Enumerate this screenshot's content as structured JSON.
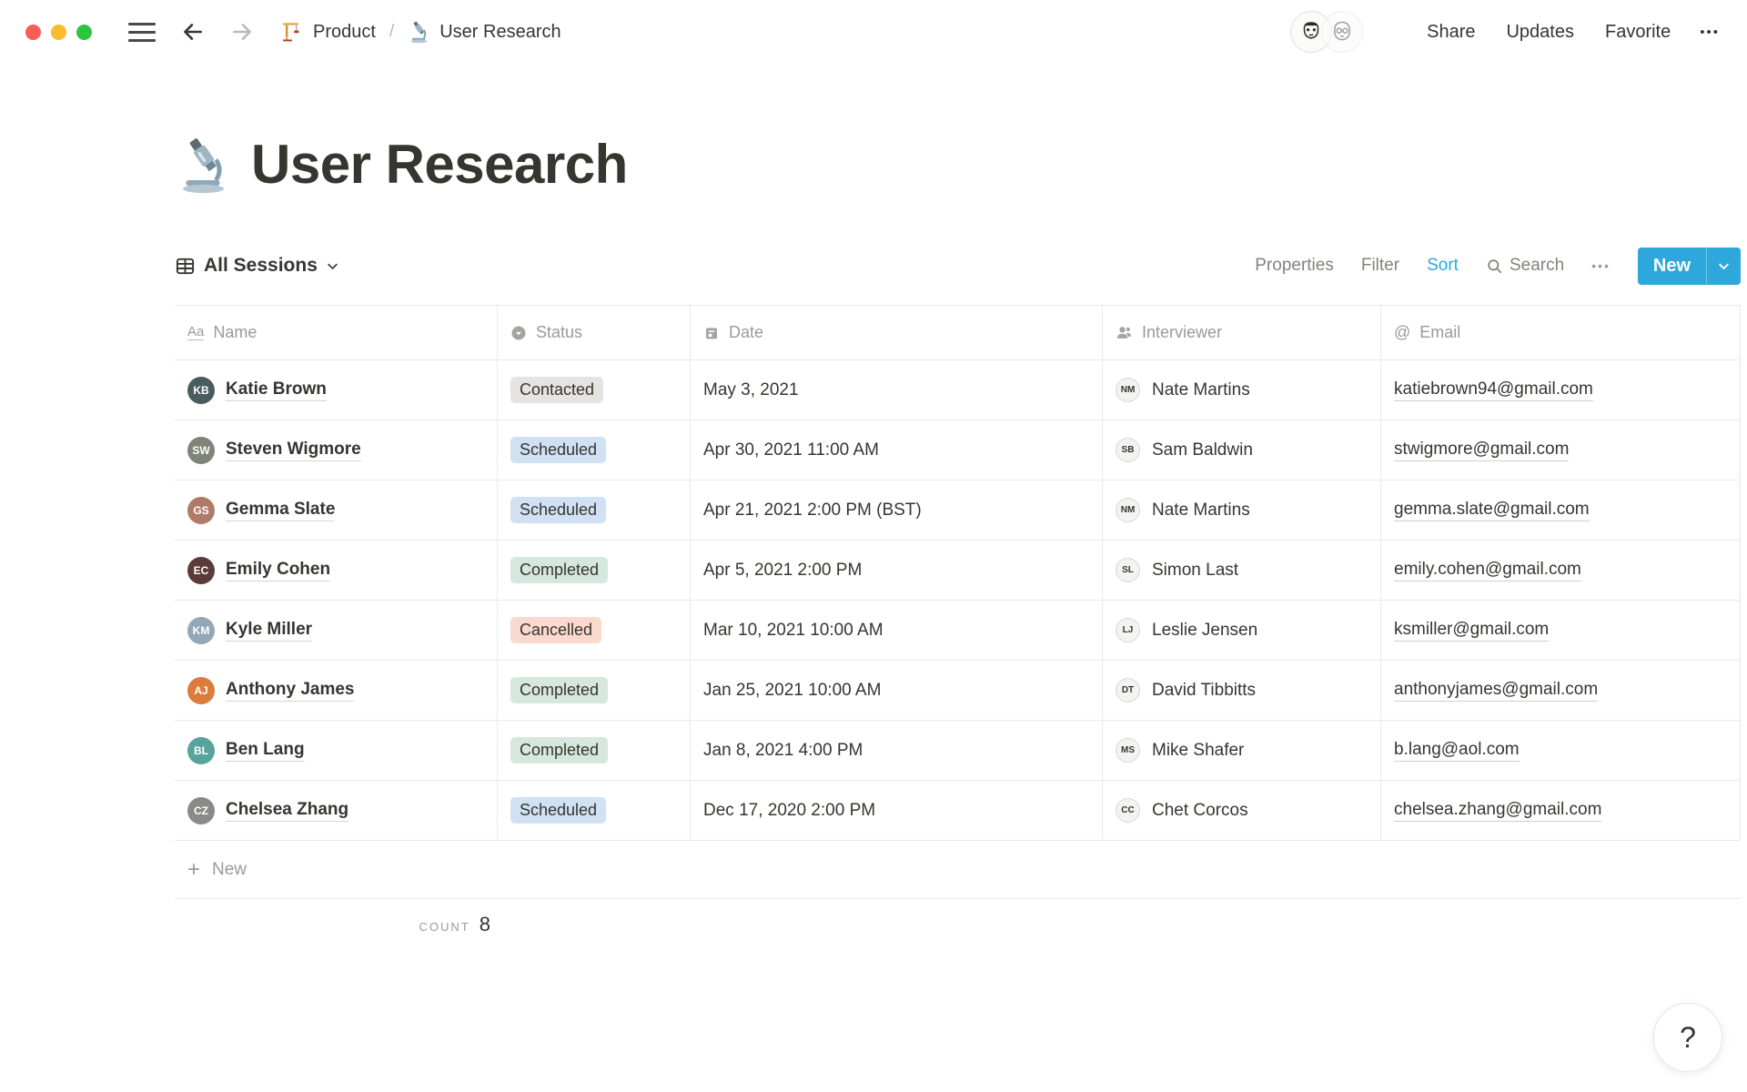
{
  "topbar": {
    "breadcrumb": {
      "parent": "Product",
      "separator": "/",
      "current": "User Research"
    },
    "share": "Share",
    "updates": "Updates",
    "favorite": "Favorite",
    "more": "•••"
  },
  "page": {
    "title": "User Research"
  },
  "view_bar": {
    "view_name": "All Sessions",
    "properties": "Properties",
    "filter": "Filter",
    "sort": "Sort",
    "search": "Search",
    "more": "•••",
    "new_button": "New"
  },
  "table": {
    "columns": [
      {
        "label": "Name",
        "icon": "title-property-icon"
      },
      {
        "label": "Status",
        "icon": "select-property-icon"
      },
      {
        "label": "Date",
        "icon": "calendar-icon"
      },
      {
        "label": "Interviewer",
        "icon": "person-icon"
      },
      {
        "label": "Email",
        "icon": "at-icon"
      }
    ],
    "rows": [
      {
        "name": "Katie Brown",
        "initials": "KB",
        "avatar_color": "#4A5D5E",
        "status": "Contacted",
        "status_color": "gray",
        "date": "May 3, 2021",
        "interviewer": "Nate Martins",
        "interviewer_initials": "NM",
        "email": "katiebrown94@gmail.com"
      },
      {
        "name": "Steven Wigmore",
        "initials": "SW",
        "avatar_color": "#7E8578",
        "status": "Scheduled",
        "status_color": "blue",
        "date": "Apr 30, 2021 11:00 AM",
        "interviewer": "Sam Baldwin",
        "interviewer_initials": "SB",
        "email": "stwigmore@gmail.com"
      },
      {
        "name": "Gemma Slate",
        "initials": "GS",
        "avatar_color": "#B07A68",
        "status": "Scheduled",
        "status_color": "blue",
        "date": "Apr 21, 2021 2:00 PM (BST)",
        "interviewer": "Nate Martins",
        "interviewer_initials": "NM",
        "email": "gemma.slate@gmail.com"
      },
      {
        "name": "Emily Cohen",
        "initials": "EC",
        "avatar_color": "#5C3A38",
        "status": "Completed",
        "status_color": "green",
        "date": "Apr 5, 2021 2:00 PM",
        "interviewer": "Simon Last",
        "interviewer_initials": "SL",
        "email": "emily.cohen@gmail.com"
      },
      {
        "name": "Kyle Miller",
        "initials": "KM",
        "avatar_color": "#93A7B6",
        "status": "Cancelled",
        "status_color": "red",
        "date": "Mar 10, 2021 10:00 AM",
        "interviewer": "Leslie Jensen",
        "interviewer_initials": "LJ",
        "email": "ksmiller@gmail.com"
      },
      {
        "name": "Anthony James",
        "initials": "AJ",
        "avatar_color": "#DB7C3C",
        "status": "Completed",
        "status_color": "green",
        "date": "Jan 25, 2021 10:00 AM",
        "interviewer": "David Tibbitts",
        "interviewer_initials": "DT",
        "email": "anthonyjames@gmail.com"
      },
      {
        "name": "Ben Lang",
        "initials": "BL",
        "avatar_color": "#58A39B",
        "status": "Completed",
        "status_color": "green",
        "date": "Jan 8, 2021 4:00 PM",
        "interviewer": "Mike Shafer",
        "interviewer_initials": "MS",
        "email": "b.lang@aol.com"
      },
      {
        "name": "Chelsea Zhang",
        "initials": "CZ",
        "avatar_color": "#8A8A88",
        "status": "Scheduled",
        "status_color": "blue",
        "date": "Dec 17, 2020 2:00 PM",
        "interviewer": "Chet Corcos",
        "interviewer_initials": "CC",
        "email": "chelsea.zhang@gmail.com"
      }
    ],
    "new_row_label": "New",
    "count_label": "COUNT",
    "count_value": "8"
  },
  "icons": {
    "title_property": "Aa",
    "email_at": "@",
    "plus": "+"
  },
  "help_button": "?",
  "colors": {
    "accent_blue": "#2EA8DC",
    "badge_gray": "#E5E4E1",
    "badge_blue": "#CFE1F3",
    "badge_green": "#D6E8DD",
    "badge_red": "#FAD9CE",
    "border": "#E9E9E7",
    "text_dark": "#37352F",
    "text_gray": "#9B9A97"
  }
}
